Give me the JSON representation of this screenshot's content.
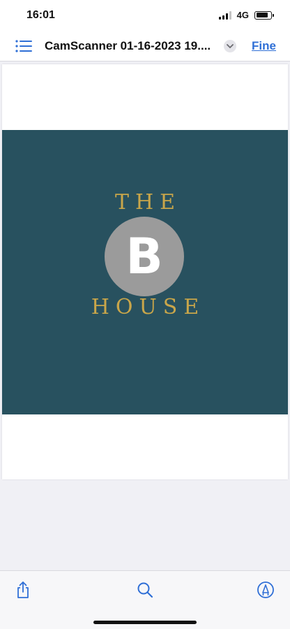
{
  "status_bar": {
    "time": "16:01",
    "network": "4G"
  },
  "nav_bar": {
    "title": "CamScanner 01-16-2023 19....",
    "done_label": "Fine"
  },
  "document": {
    "logo_top_text": "THE",
    "logo_letter": "B",
    "logo_bottom_text": "HOUSE"
  },
  "colors": {
    "accent": "#2f6fd6",
    "logo_background": "#28515f",
    "logo_gold": "#c9a64a",
    "logo_circle": "#9b9b9b"
  },
  "icons": {
    "list": "list-icon",
    "chevron": "chevron-down-icon",
    "share": "share-icon",
    "search": "search-icon",
    "markup": "markup-pen-icon"
  }
}
